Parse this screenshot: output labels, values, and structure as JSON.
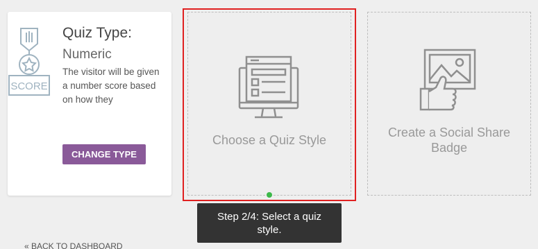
{
  "quiz_type_card": {
    "icon_text": "SCORE",
    "label": "Quiz Type:",
    "value": "Numeric",
    "description": "The visitor will be given a number score based on how they",
    "change_button": "CHANGE TYPE"
  },
  "options": {
    "quiz_style": {
      "label": "Choose a Quiz Style",
      "icon": "quiz-layout-monitor-icon"
    },
    "social_badge": {
      "label": "Create a Social Share Badge",
      "icon": "image-thumbs-up-icon"
    }
  },
  "tooltip": {
    "text": "Step 2/4: Select a quiz style."
  },
  "footer": {
    "back_link": "« BACK TO DASHBOARD"
  },
  "colors": {
    "accent_purple": "#8a5a99",
    "highlight_red": "#e02020",
    "step_green": "#3db84a",
    "tooltip_bg": "#333333"
  }
}
